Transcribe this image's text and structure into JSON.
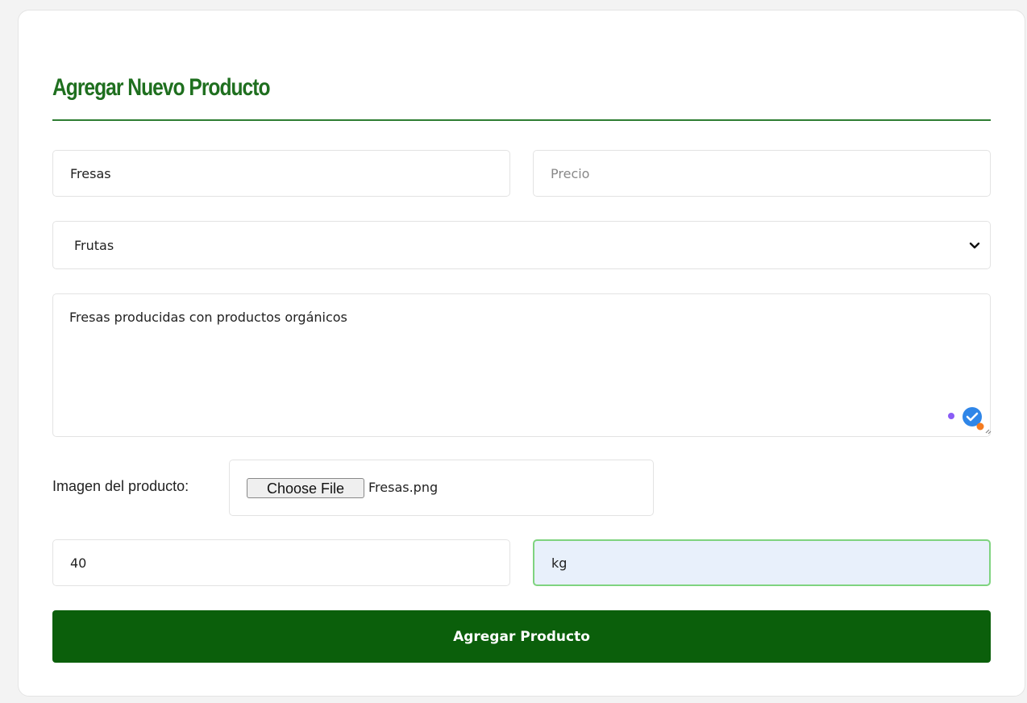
{
  "form": {
    "title": "Agregar Nuevo Producto",
    "name": {
      "value": "Fresas",
      "placeholder": ""
    },
    "price": {
      "value": "",
      "placeholder": "Precio"
    },
    "category": {
      "selected": "Frutas"
    },
    "description": {
      "value": "Fresas producidas con productos orgánicos"
    },
    "image": {
      "label": "Imagen del producto:",
      "button_label": "Choose File",
      "file_name": "Fresas.png"
    },
    "quantity": {
      "value": "40"
    },
    "unit": {
      "value": "kg"
    },
    "submit_label": "Agregar Producto"
  },
  "colors": {
    "accent": "#1f6f1f",
    "submit_bg": "#0b5f0b",
    "focus_border": "#7fd37f",
    "focus_bg": "#e8f0fb"
  },
  "icons": {
    "select": "chevron-down-icon",
    "textarea_extension": "grammar-checker-icon"
  }
}
